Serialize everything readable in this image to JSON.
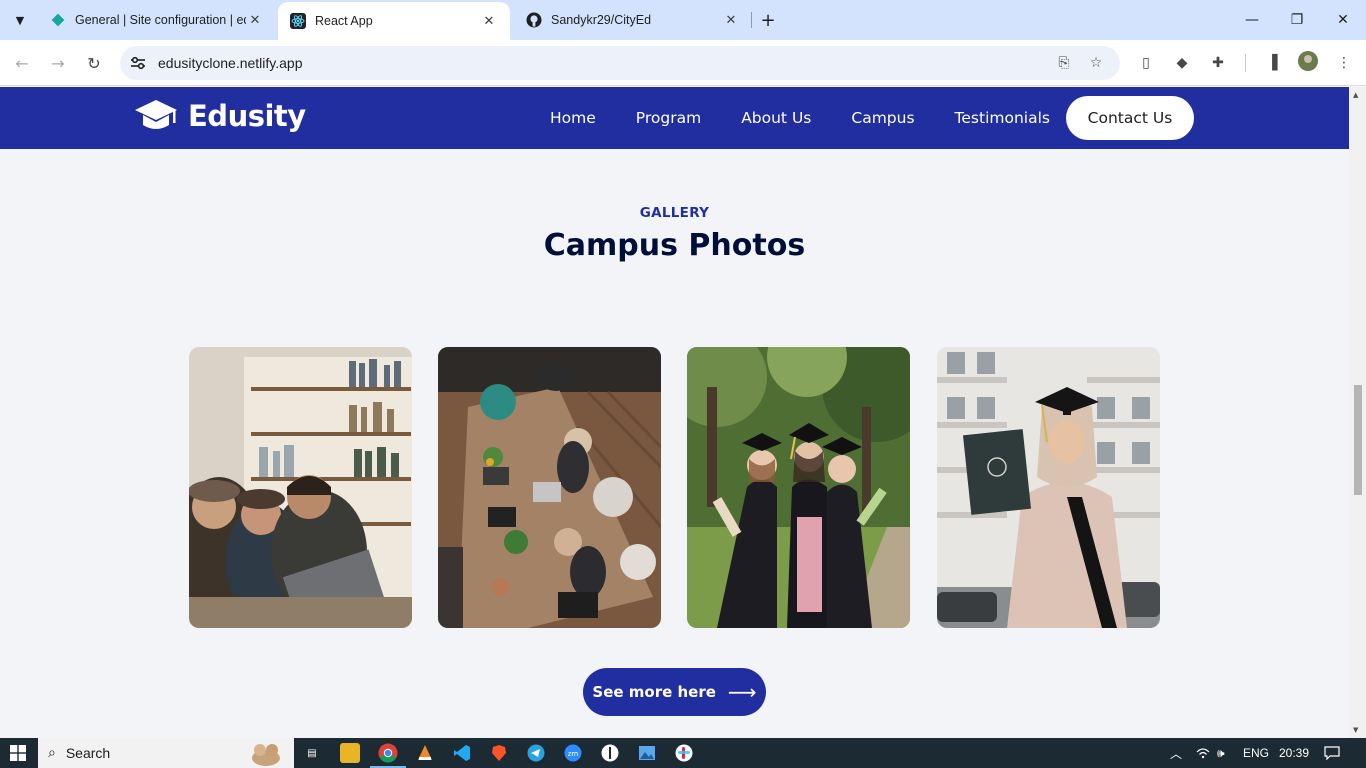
{
  "browser": {
    "tabs": [
      {
        "title": "General | Site configuration | edusityclone",
        "favicon": "netlify-diamond-icon",
        "active": false
      },
      {
        "title": "React App",
        "favicon": "react-icon",
        "active": true
      },
      {
        "title": "Sandykr29/CityEd",
        "favicon": "github-icon",
        "active": false
      }
    ],
    "url": "edusityclone.netlify.app"
  },
  "site": {
    "logo_text": "Edusity",
    "nav": [
      "Home",
      "Program",
      "About Us",
      "Campus",
      "Testimonials"
    ],
    "contact_label": "Contact Us",
    "accent_color": "#212ea0",
    "title_color": "#000f38"
  },
  "gallery": {
    "eyebrow": "GALLERY",
    "title": "Campus Photos",
    "photos": [
      {
        "subject": "students laughing at laptop in library"
      },
      {
        "subject": "people working at long wooden table, top view"
      },
      {
        "subject": "three graduates in caps and gowns outdoors"
      },
      {
        "subject": "graduate in hijab holding diploma"
      }
    ],
    "cta_label": "See more here",
    "cta_arrow": "⟶"
  },
  "taskbar": {
    "search_label": "Search",
    "language": "ENG",
    "time": "20:39"
  }
}
